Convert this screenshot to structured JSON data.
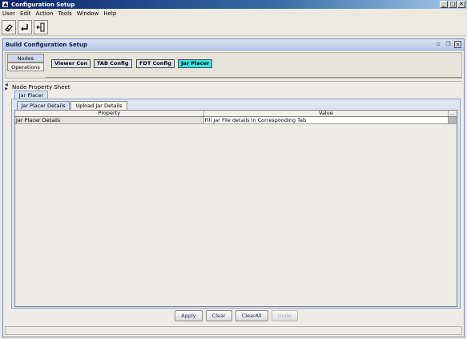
{
  "window": {
    "title": "Configuration Setup",
    "controls": [
      "_",
      "□",
      "✕"
    ]
  },
  "menu": [
    "User",
    "Edit",
    "Action",
    "Tools",
    "Window",
    "Help"
  ],
  "toolbar": {
    "icons": [
      "eraser-icon",
      "back-icon",
      "exit-icon"
    ]
  },
  "frame": {
    "title": "Build Configuration Setup"
  },
  "nav_tabs": {
    "nodes": "Nodes",
    "operations": "Operations"
  },
  "node_buttons": [
    {
      "label": "Viewer Con",
      "active": false
    },
    {
      "label": "TAB Config",
      "active": false
    },
    {
      "label": "FDT Config",
      "active": false
    },
    {
      "label": "Jar Placer",
      "active": true
    }
  ],
  "sheet": {
    "title": "Node Property Sheet",
    "tab": "Jar Placer",
    "subtabs": [
      "Jar Placer Details",
      "Upload Jar Details"
    ],
    "columns": {
      "property": "Property",
      "value": "Value",
      "more": "..."
    },
    "rows": [
      {
        "property": "Jar Placer Details",
        "value": "Fill Jar File details in Corresponding Tab"
      }
    ]
  },
  "actions": {
    "apply": "Apply",
    "clear": "Clear",
    "clear_all": "ClearAll",
    "undo": "Undo"
  },
  "colors": {
    "active_node": "#33e6e6",
    "title_gradient_start": "#0a246a"
  }
}
